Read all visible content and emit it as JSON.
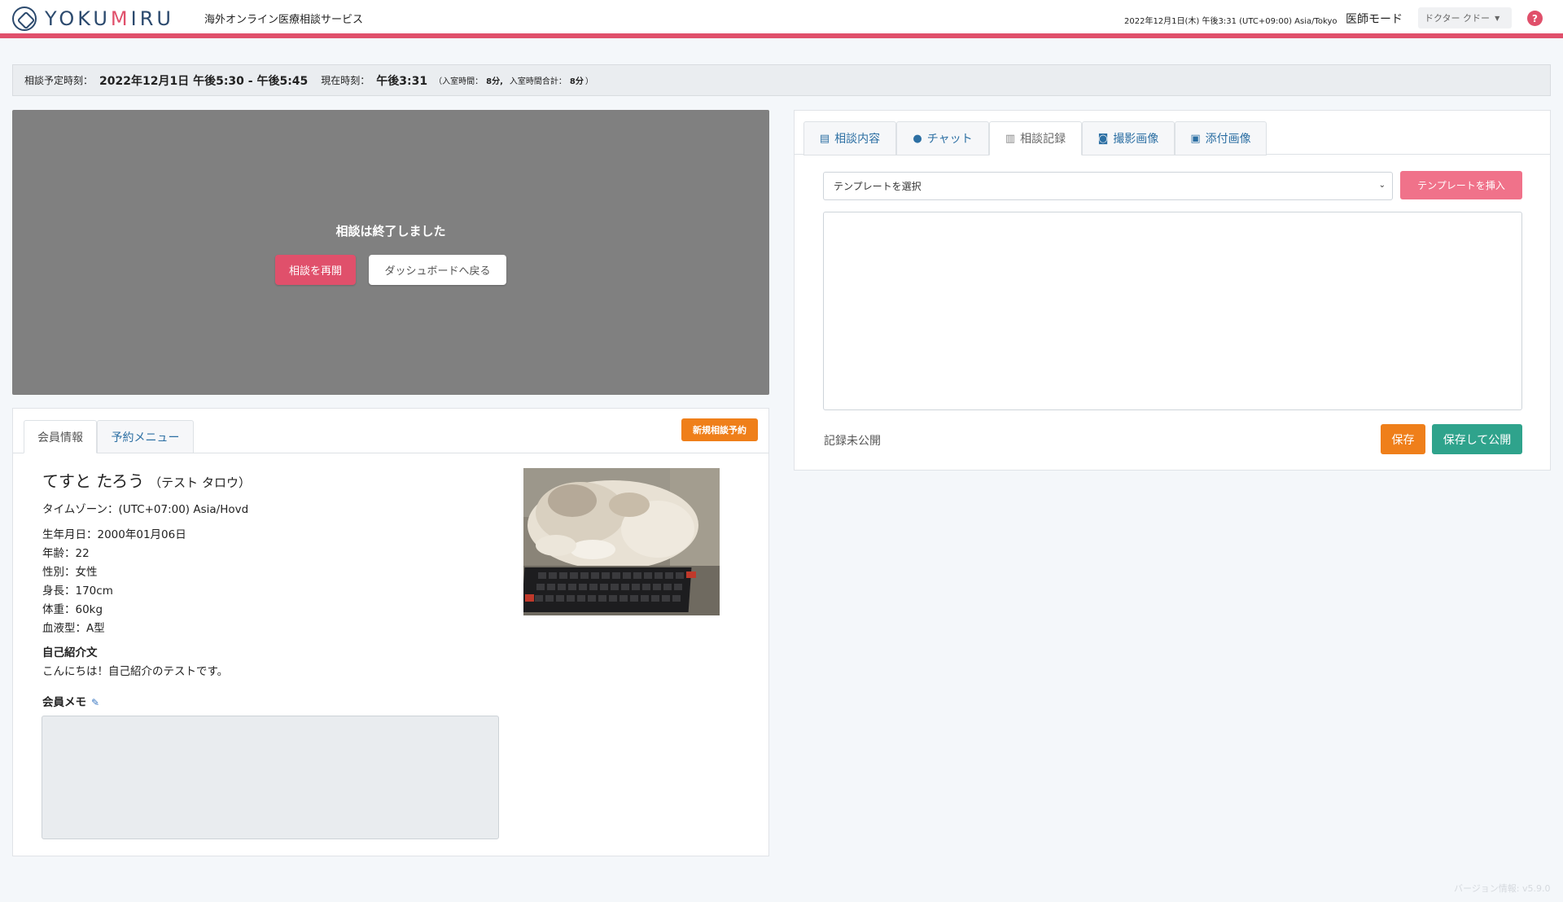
{
  "header": {
    "logo_text_1": "YOKU",
    "logo_text_m": "M",
    "logo_text_2": "IRU",
    "tagline": "海外オンライン医療相談サービス",
    "datetime": "2022年12月1日(木) 午後3:31 (UTC+09:00) Asia/Tokyo",
    "mode": "医師モード",
    "user": "ドクター クドー",
    "help": "?"
  },
  "infobar": {
    "scheduled_label": "相談予定時刻：",
    "scheduled_value": "2022年12月1日 午後5:30 - 午後5:45",
    "now_label": "現在時刻：",
    "now_value": "午後3:31",
    "room_open": "（",
    "room_label": "入室時間：",
    "room_value": "8分,",
    "room_total_label": "入室時間合計：",
    "room_total_value": "8分",
    "room_close": "）"
  },
  "video": {
    "message": "相談は終了しました",
    "resume_label": "相談を再開",
    "back_label": "ダッシュボードへ戻る"
  },
  "member": {
    "tabs": [
      "会員情報",
      "予約メニュー"
    ],
    "new_booking_label": "新規相談予約",
    "name": "てすと たろう",
    "name_kana": "（テスト タロウ）",
    "timezone": "タイムゾーン：(UTC+07:00) Asia/Hovd",
    "birthday": "生年月日：2000年01月06日",
    "age": "年齢：22",
    "gender": "性別：女性",
    "height": "身長：170cm",
    "weight": "体重：60kg",
    "blood": "血液型：A型",
    "intro_heading": "自己紹介文",
    "intro_text": "こんにちは！自己紹介のテストです。",
    "memo_heading": "会員メモ"
  },
  "record": {
    "tabs": [
      {
        "label": "相談内容",
        "icon": "document-icon"
      },
      {
        "label": "チャット",
        "icon": "chat-icon"
      },
      {
        "label": "相談記録",
        "icon": "clipboard-icon"
      },
      {
        "label": "撮影画像",
        "icon": "camera-icon"
      },
      {
        "label": "添付画像",
        "icon": "image-icon"
      }
    ],
    "active_tab": 2,
    "template_placeholder": "テンプレートを選択",
    "insert_label": "テンプレートを挿入",
    "status": "記録未公開",
    "save_label": "保存",
    "publish_label": "保存して公開"
  },
  "footer": {
    "version": "バージョン情報: v5.9.0"
  },
  "colors": {
    "brand_pink": "#e0506b",
    "brand_navy": "#2c4a6e",
    "orange": "#ef7f1a",
    "teal": "#2fa38c",
    "link_blue": "#2c6fa3"
  }
}
